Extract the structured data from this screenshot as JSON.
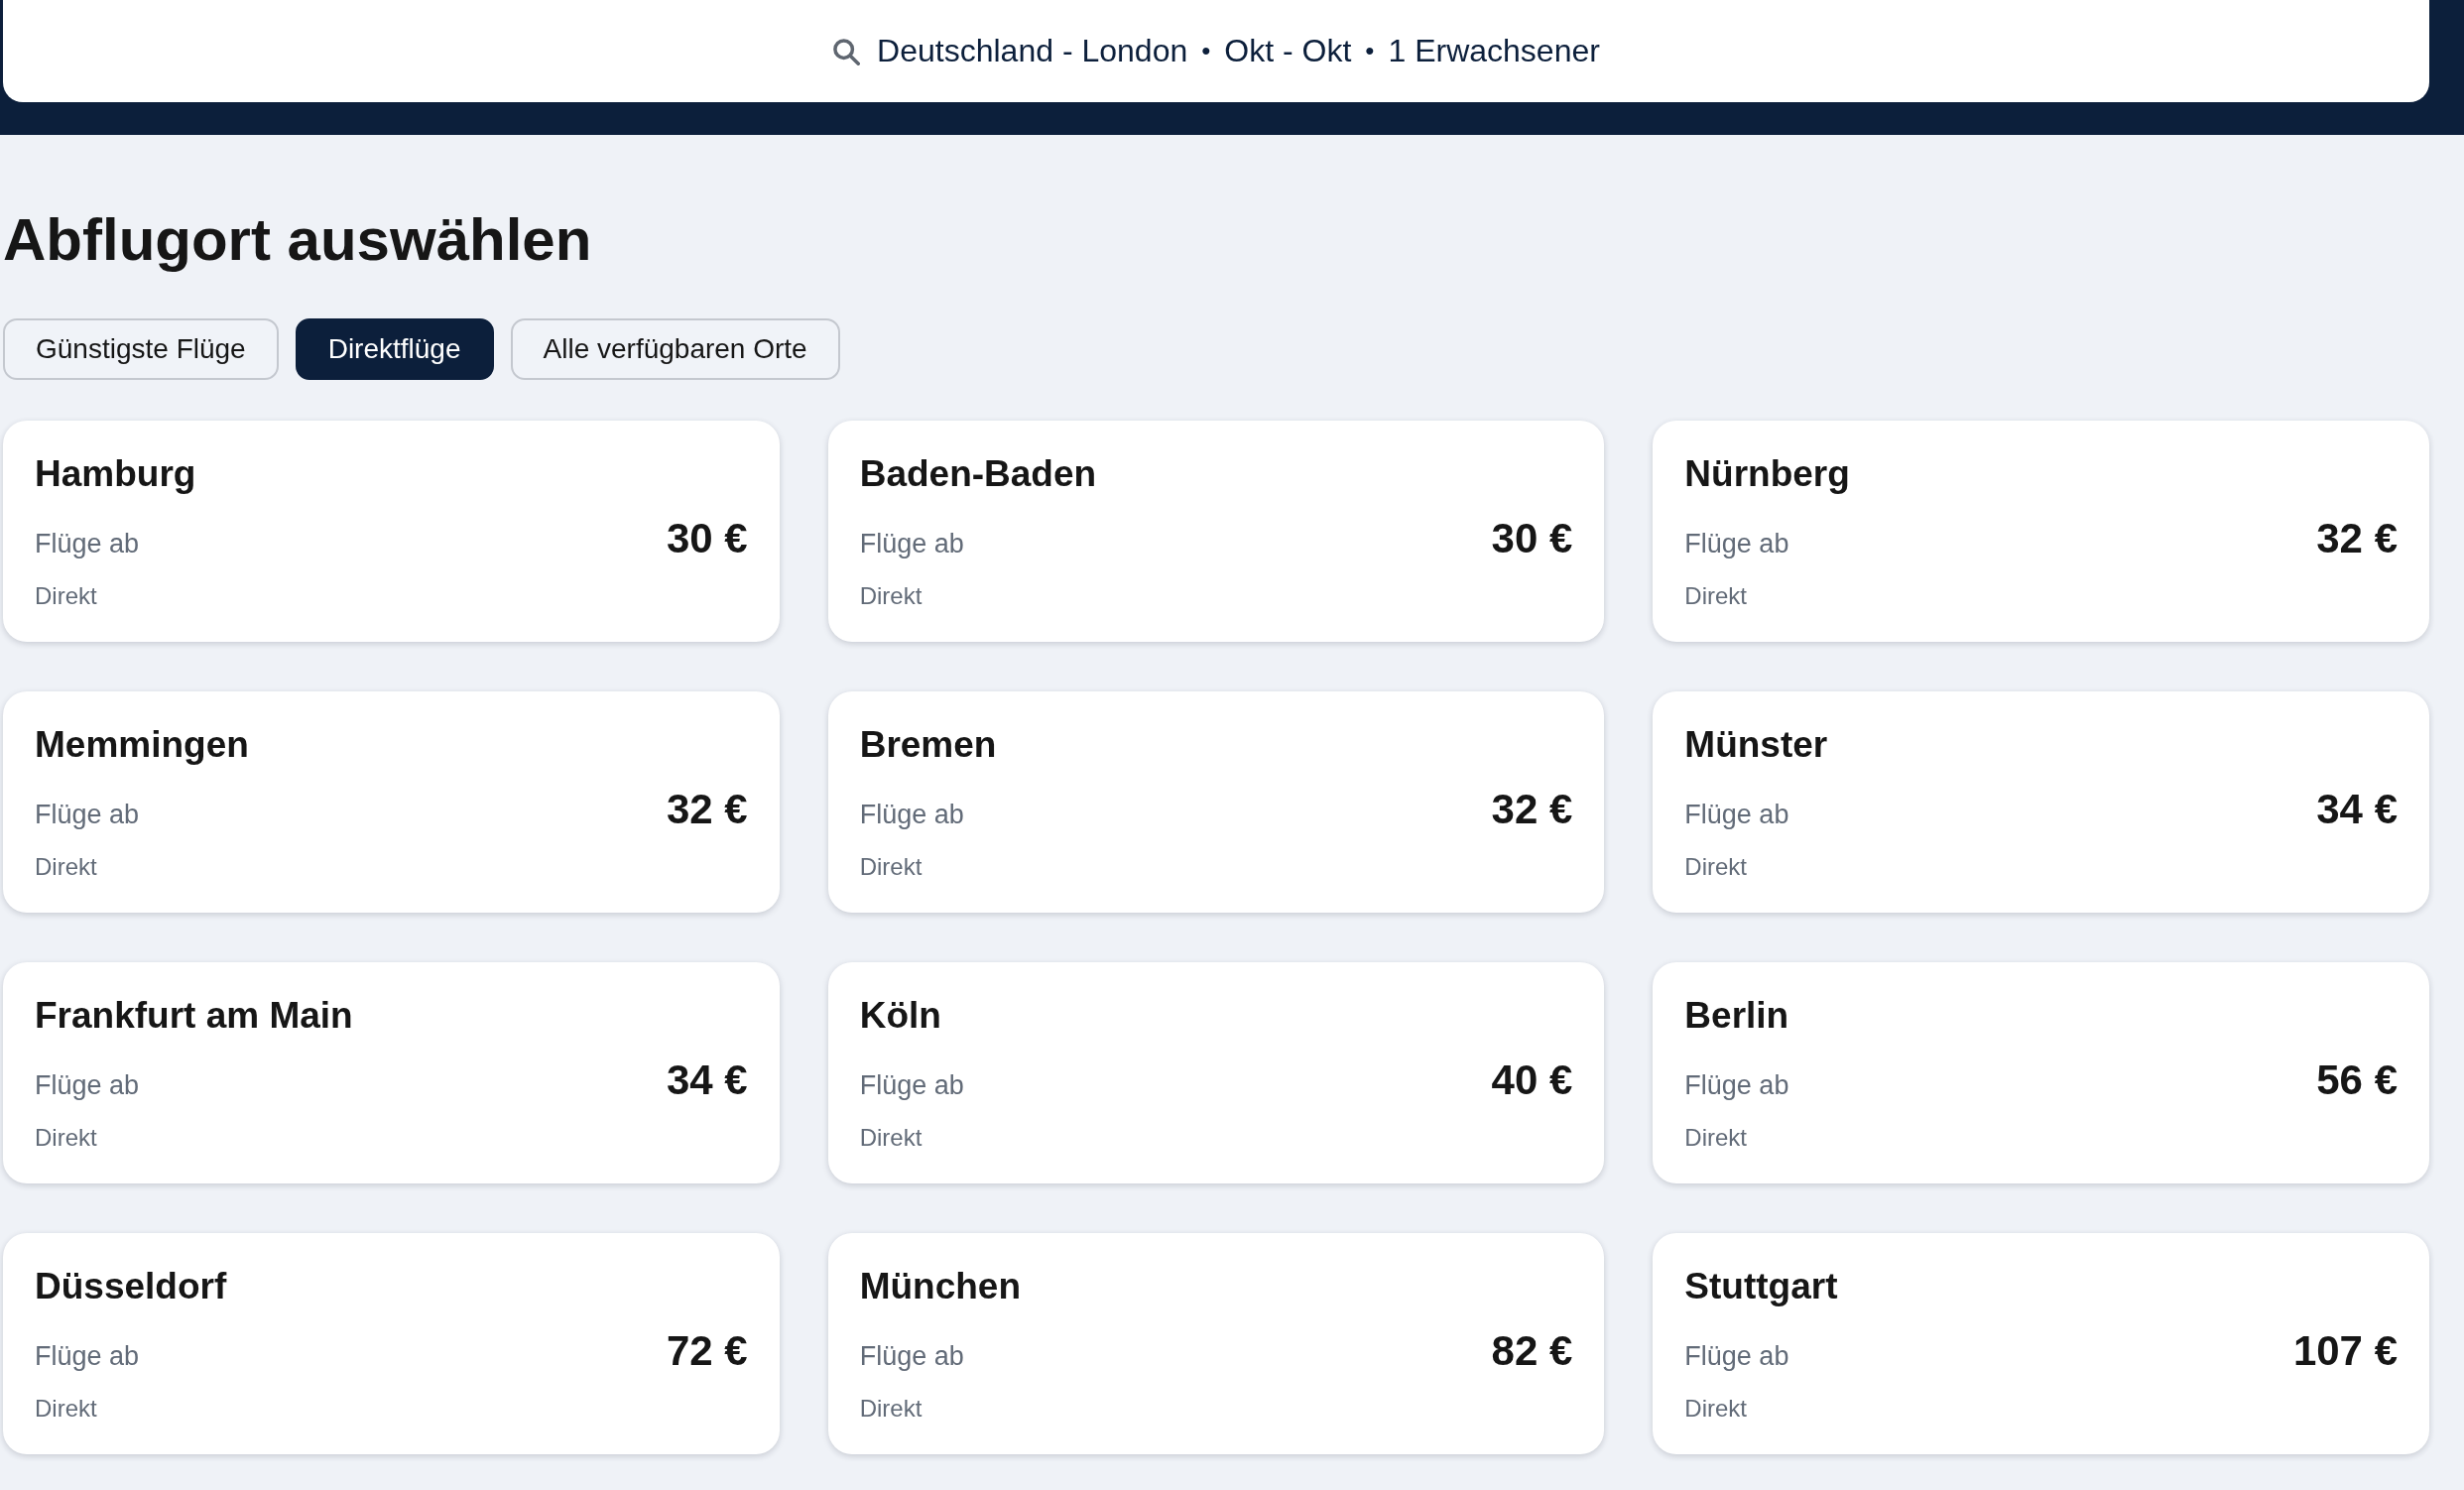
{
  "header": {
    "search_summary": {
      "parts": [
        "Deutschland - London",
        "Okt - Okt",
        "1 Erwachsener"
      ],
      "separators": [
        "•",
        "•"
      ]
    }
  },
  "title": "Abflugort auswählen",
  "filter_tabs": [
    {
      "label": "Günstigste Flüge",
      "selected": false
    },
    {
      "label": "Direktflüge",
      "selected": true
    },
    {
      "label": "Alle verfügbaren Orte",
      "selected": false
    }
  ],
  "destinations": [
    {
      "city": "Hamburg",
      "caption": "Flüge ab",
      "price": "30 €",
      "stops": "Direkt"
    },
    {
      "city": "Baden-Baden",
      "caption": "Flüge ab",
      "price": "30 €",
      "stops": "Direkt"
    },
    {
      "city": "Nürnberg",
      "caption": "Flüge ab",
      "price": "32 €",
      "stops": "Direkt"
    },
    {
      "city": "Memmingen",
      "caption": "Flüge ab",
      "price": "32 €",
      "stops": "Direkt"
    },
    {
      "city": "Bremen",
      "caption": "Flüge ab",
      "price": "32 €",
      "stops": "Direkt"
    },
    {
      "city": "Münster",
      "caption": "Flüge ab",
      "price": "34 €",
      "stops": "Direkt"
    },
    {
      "city": "Frankfurt am Main",
      "caption": "Flüge ab",
      "price": "34 €",
      "stops": "Direkt"
    },
    {
      "city": "Köln",
      "caption": "Flüge ab",
      "price": "40 €",
      "stops": "Direkt"
    },
    {
      "city": "Berlin",
      "caption": "Flüge ab",
      "price": "56 €",
      "stops": "Direkt"
    },
    {
      "city": "Düsseldorf",
      "caption": "Flüge ab",
      "price": "72 €",
      "stops": "Direkt"
    },
    {
      "city": "München",
      "caption": "Flüge ab",
      "price": "82 €",
      "stops": "Direkt"
    },
    {
      "city": "Stuttgart",
      "caption": "Flüge ab",
      "price": "107 €",
      "stops": "Direkt"
    }
  ]
}
